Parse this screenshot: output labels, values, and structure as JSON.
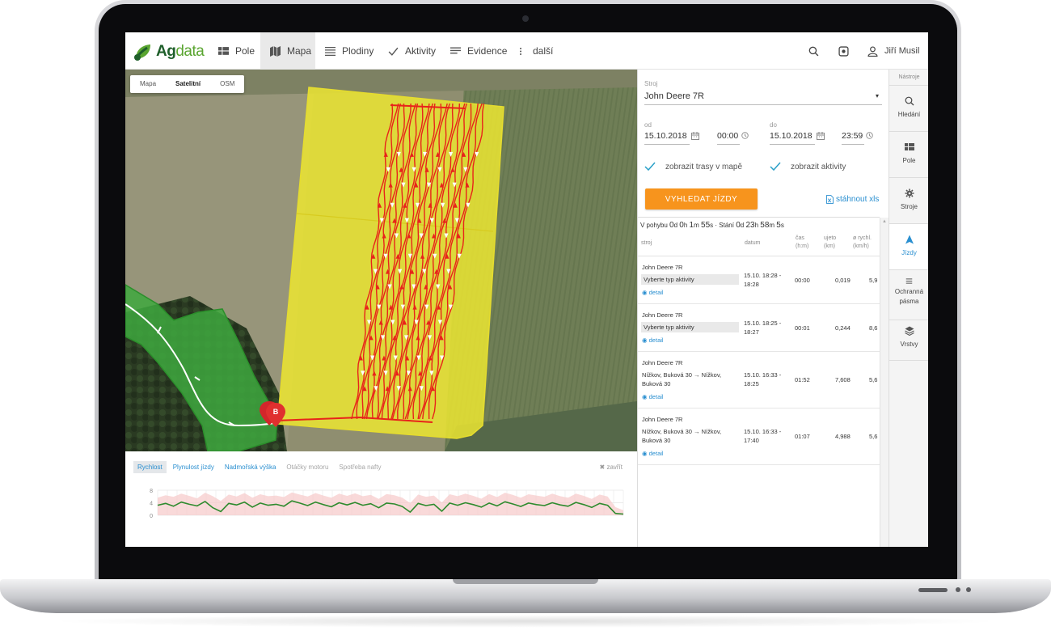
{
  "app": {
    "logo_ag": "Ag",
    "logo_data": "data"
  },
  "nav": {
    "items": [
      {
        "label": "Pole",
        "icon": "grid-icon"
      },
      {
        "label": "Mapa",
        "icon": "map-icon",
        "active": true
      },
      {
        "label": "Plodiny",
        "icon": "list-icon"
      },
      {
        "label": "Aktivity",
        "icon": "check-icon"
      },
      {
        "label": "Evidence",
        "icon": "lines-icon"
      },
      {
        "label": "další",
        "icon": "more-icon"
      }
    ],
    "user": "Jiří Musil"
  },
  "map": {
    "layers": [
      "Mapa",
      "Satelitní",
      "OSM"
    ],
    "selected_layer": "Satelitní",
    "end_marker": "B"
  },
  "chart_panel": {
    "tabs": [
      "Rychlost",
      "Plynulost jízdy",
      "Nadmořská výška",
      "Otáčky motoru",
      "Spotřeba nafty"
    ],
    "selected_tab": "Rychlost",
    "close_label": "✖ zavřít"
  },
  "chart_data": {
    "type": "line",
    "y_ticks": [
      "8",
      "4",
      "0"
    ],
    "ylim": [
      0,
      8
    ],
    "series": [
      {
        "values": [
          3.2,
          3.8,
          2.9,
          4.2,
          3.5,
          3.0,
          4.4,
          2.4,
          1.2,
          3.8,
          3.3,
          4.2,
          2.6,
          3.9,
          3.2,
          3.5,
          2.9,
          4.6,
          3.9,
          3.1,
          4.2,
          3.4,
          2.7,
          4.0,
          3.3,
          4.1,
          3.2,
          3.7,
          2.4,
          3.9,
          3.6,
          2.8,
          1.0,
          3.8,
          3.1,
          3.5,
          1.3,
          3.9,
          3.2,
          4.0,
          3.4,
          2.6,
          3.9,
          3.0,
          4.3,
          3.6,
          2.8,
          3.9,
          3.4,
          3.1,
          4.0,
          3.3,
          2.9,
          4.1,
          3.4,
          2.5,
          3.8,
          3.2,
          0.6,
          0.4
        ]
      }
    ],
    "fill_series": [
      5.6,
      6.4,
      5.9,
      6.9,
      6.2,
      5.4,
      7.2,
      6.1,
      4.6,
      6.6,
      6.0,
      7.1,
      5.6,
      6.7,
      6.1,
      6.3,
      5.8,
      7.3,
      6.6,
      6.0,
      7.1,
      6.3,
      5.6,
      6.9,
      6.2,
      7.0,
      6.1,
      6.5,
      5.2,
      6.8,
      6.4,
      5.6,
      3.9,
      6.6,
      5.9,
      6.3,
      4.1,
      6.7,
      6.1,
      6.9,
      6.2,
      5.3,
      6.8,
      5.8,
      7.2,
      6.5,
      5.6,
      6.7,
      6.3,
      5.9,
      6.9,
      6.1,
      5.6,
      6.9,
      6.2,
      5.2,
      6.6,
      6.0,
      2.6,
      1.6
    ]
  },
  "panel": {
    "machine_label": "Stroj",
    "machine_value": "John Deere 7R",
    "from_label": "od",
    "from_date": "15.10.2018",
    "from_time": "00:00",
    "to_label": "do",
    "to_date": "15.10.2018",
    "to_time": "23:59",
    "show_routes": "zobrazit trasy v mapě",
    "show_activities": "zobrazit aktivity",
    "search_button": "VYHLEDAT JÍZDY",
    "download_xls": "stáhnout xls",
    "stats": {
      "moving_label": "V pohybu",
      "moving": [
        "0",
        "d",
        "0",
        "h",
        "1",
        "m",
        "55",
        "s"
      ],
      "sep": "·",
      "standing_label": "Stání",
      "standing": [
        "0",
        "d",
        "23",
        "h",
        "58",
        "m",
        "5",
        "s"
      ]
    },
    "headers": {
      "machine": "stroj",
      "date": "datum",
      "time": "čas",
      "time_unit": "(h:m)",
      "dist": "ujeto",
      "dist_unit": "(km)",
      "speed": "ø rychl.",
      "speed_unit": "(km/h)"
    },
    "rows": [
      {
        "machine": "John Deere 7R",
        "activity": "Vyberte typ aktivity",
        "date1": "15.10. 18:28 -",
        "date2": "18:28",
        "time": "00:00",
        "dist": "0,019",
        "speed": "5,9",
        "detail": "detail"
      },
      {
        "machine": "John Deere 7R",
        "activity": "Vyberte typ aktivity",
        "date1": "15.10. 18:25 -",
        "date2": "18:27",
        "time": "00:01",
        "dist": "0,244",
        "speed": "8,6",
        "detail": "detail"
      },
      {
        "machine": "John Deere 7R",
        "route1": "Nížkov, Buková 30 → Nížkov,",
        "route2": "Buková 30",
        "date1": "15.10. 16:33 -",
        "date2": "18:25",
        "time": "01:52",
        "dist": "7,608",
        "speed": "5,6",
        "detail": "detail"
      },
      {
        "machine": "John Deere 7R",
        "route1": "Nížkov, Buková 30 → Nížkov,",
        "route2": "Buková 30",
        "date1": "15.10. 16:33 -",
        "date2": "17:40",
        "time": "01:07",
        "dist": "4,988",
        "speed": "5,6",
        "detail": "detail"
      }
    ]
  },
  "tools": {
    "title": "Nástroje",
    "items": [
      {
        "label": "Hledání",
        "icon": "search-icon"
      },
      {
        "label": "Pole",
        "icon": "grid-icon"
      },
      {
        "label": "Stroje",
        "icon": "gear-icon"
      },
      {
        "label": "Jízdy",
        "icon": "navigation-arrow-icon",
        "active": true
      },
      {
        "label": "Ochranná",
        "label2": "pásma",
        "icon": "menu-icon"
      },
      {
        "label": "Vrstvy",
        "icon": "layers-icon"
      }
    ]
  },
  "colors": {
    "accent": "#2a8fd0",
    "button": "#f7941d",
    "route": "#e8231a",
    "field": "#e5e24a",
    "brand": "#5aa531"
  }
}
